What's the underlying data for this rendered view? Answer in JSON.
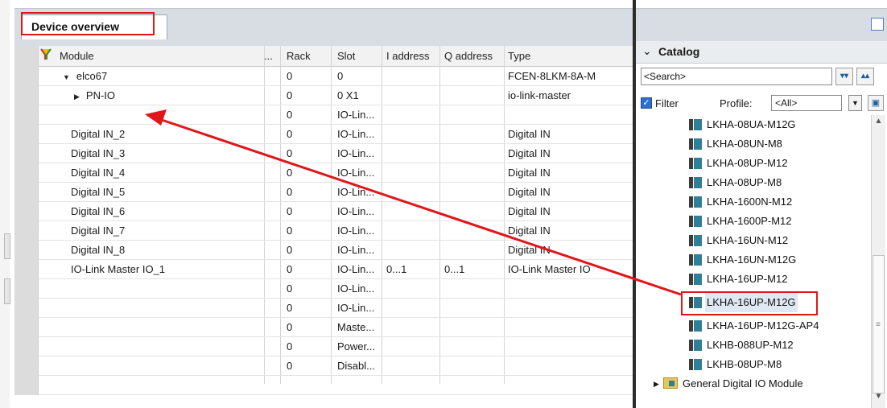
{
  "device_overview": {
    "tab_label": "Device overview",
    "columns": {
      "module": "Module",
      "dots": "...",
      "rack": "Rack",
      "slot": "Slot",
      "i_address": "I address",
      "q_address": "Q address",
      "type": "Type"
    },
    "rows": [
      {
        "module": "elco67",
        "rack": "0",
        "slot": "0",
        "i_address": "",
        "q_address": "",
        "type": "FCEN-8LKM-8A-M"
      },
      {
        "module": "PN-IO",
        "rack": "0",
        "slot": "0 X1",
        "i_address": "",
        "q_address": "",
        "type": "io-link-master"
      },
      {
        "module": "",
        "rack": "0",
        "slot": "IO-Lin...",
        "i_address": "",
        "q_address": "",
        "type": ""
      },
      {
        "module": "Digital IN_2",
        "rack": "0",
        "slot": "IO-Lin...",
        "i_address": "",
        "q_address": "",
        "type": "Digital IN"
      },
      {
        "module": "Digital IN_3",
        "rack": "0",
        "slot": "IO-Lin...",
        "i_address": "",
        "q_address": "",
        "type": "Digital IN"
      },
      {
        "module": "Digital IN_4",
        "rack": "0",
        "slot": "IO-Lin...",
        "i_address": "",
        "q_address": "",
        "type": "Digital IN"
      },
      {
        "module": "Digital IN_5",
        "rack": "0",
        "slot": "IO-Lin...",
        "i_address": "",
        "q_address": "",
        "type": "Digital IN"
      },
      {
        "module": "Digital IN_6",
        "rack": "0",
        "slot": "IO-Lin...",
        "i_address": "",
        "q_address": "",
        "type": "Digital IN"
      },
      {
        "module": "Digital IN_7",
        "rack": "0",
        "slot": "IO-Lin...",
        "i_address": "",
        "q_address": "",
        "type": "Digital IN"
      },
      {
        "module": "Digital IN_8",
        "rack": "0",
        "slot": "IO-Lin...",
        "i_address": "",
        "q_address": "",
        "type": "Digital IN"
      },
      {
        "module": "IO-Link Master IO_1",
        "rack": "0",
        "slot": "IO-Lin...",
        "i_address": "0...1",
        "q_address": "0...1",
        "type": "IO-Link Master IO"
      },
      {
        "module": "",
        "rack": "0",
        "slot": "IO-Lin...",
        "i_address": "",
        "q_address": "",
        "type": ""
      },
      {
        "module": "",
        "rack": "0",
        "slot": "IO-Lin...",
        "i_address": "",
        "q_address": "",
        "type": ""
      },
      {
        "module": "",
        "rack": "0",
        "slot": "Maste...",
        "i_address": "",
        "q_address": "",
        "type": ""
      },
      {
        "module": "",
        "rack": "0",
        "slot": "Power...",
        "i_address": "",
        "q_address": "",
        "type": ""
      },
      {
        "module": "",
        "rack": "0",
        "slot": "Disabl...",
        "i_address": "",
        "q_address": "",
        "type": ""
      }
    ]
  },
  "catalog": {
    "title": "Catalog",
    "search_placeholder": "<Search>",
    "filter_label": "Filter",
    "profile_label": "Profile:",
    "profile_value": "<All>",
    "items": [
      "LKHA-08UA-M12G",
      "LKHA-08UN-M8",
      "LKHA-08UP-M12",
      "LKHA-08UP-M8",
      "LKHA-1600N-M12",
      "LKHA-1600P-M12",
      "LKHA-16UN-M12",
      "LKHA-16UN-M12G",
      "LKHA-16UP-M12",
      "LKHA-16UP-M12G",
      "LKHA-16UP-M12G-AP4",
      "LKHB-088UP-M12",
      "LKHB-08UP-M8"
    ],
    "selected_item": "LKHA-16UP-M12G",
    "folder": "General Digital IO Module"
  },
  "colors": {
    "annotation_red": "#e0161a",
    "selection_bg": "#dfe8f3"
  }
}
